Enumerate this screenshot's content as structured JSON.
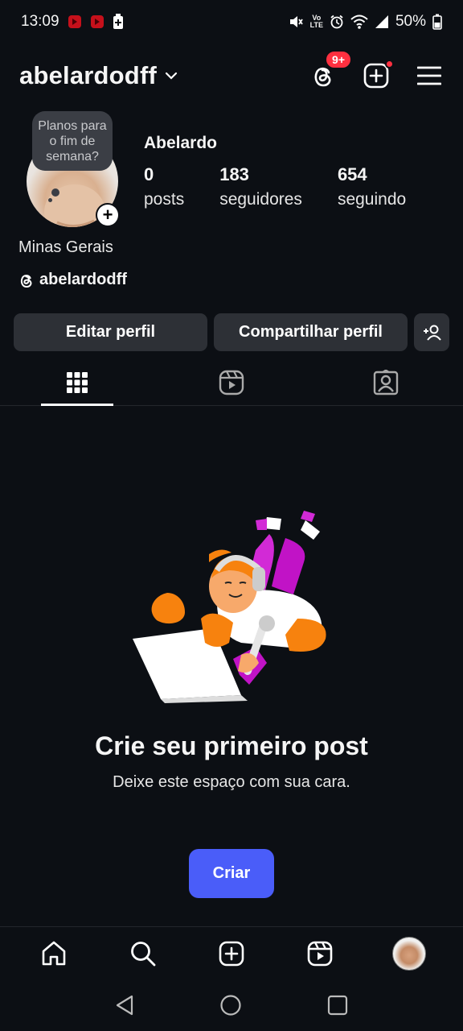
{
  "status_bar": {
    "time": "13:09",
    "battery": "50%",
    "volte_top": "Vo",
    "volte_bottom": "LTE"
  },
  "header": {
    "username": "abelardodff",
    "threads_badge": "9+"
  },
  "profile": {
    "note": "Planos para o fim de semana?",
    "display_name": "Abelardo",
    "stats": [
      {
        "value": "0",
        "label": "posts"
      },
      {
        "value": "183",
        "label": "seguidores"
      },
      {
        "value": "654",
        "label": "seguindo"
      }
    ],
    "location": "Minas Gerais",
    "threads_handle": "abelardodff"
  },
  "actions": {
    "edit": "Editar perfil",
    "share": "Compartilhar perfil"
  },
  "empty_state": {
    "title": "Crie seu primeiro post",
    "subtitle": "Deixe este espaço com sua cara.",
    "button": "Criar"
  },
  "colors": {
    "background": "#0c0f14",
    "button_bg": "#2d3036",
    "accent_blue": "#4a5df9",
    "badge_red": "#ff3040"
  },
  "icons": {
    "tabs": [
      "grid-icon",
      "reels-icon",
      "tagged-icon"
    ],
    "bottom_nav": [
      "home-icon",
      "search-icon",
      "create-icon",
      "reels-icon",
      "profile-avatar"
    ]
  }
}
